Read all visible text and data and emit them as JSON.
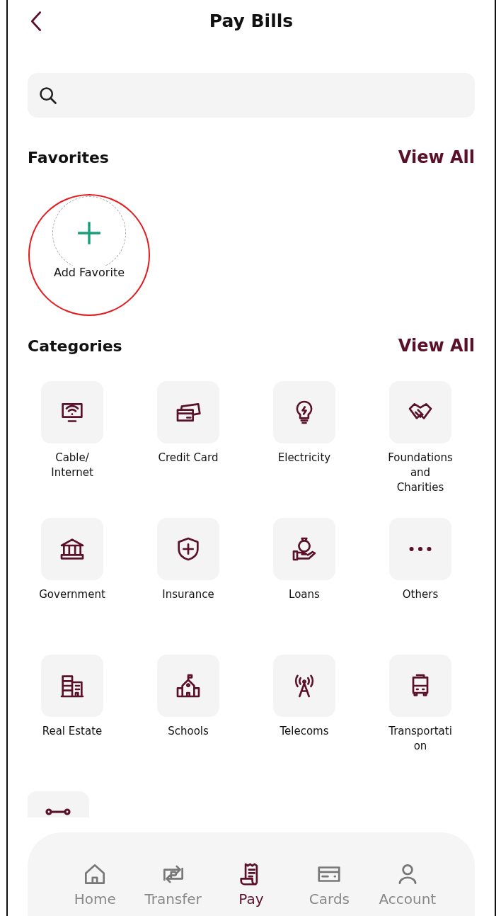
{
  "header": {
    "title": "Pay Bills"
  },
  "favorites": {
    "title": "Favorites",
    "view_all": "View All",
    "add_favorite": {
      "label": "Add Favorite",
      "highlighted": true
    }
  },
  "categories": {
    "title": "Categories",
    "view_all": "View All",
    "more_tiles_below": true,
    "items": [
      {
        "label": "Cable/ Internet"
      },
      {
        "label": "Credit Card"
      },
      {
        "label": "Electricity"
      },
      {
        "label": "Foundations and Charities"
      },
      {
        "label": "Government"
      },
      {
        "label": "Insurance"
      },
      {
        "label": "Loans"
      },
      {
        "label": "Others"
      },
      {
        "label": "Real Estate"
      },
      {
        "label": "Schools"
      },
      {
        "label": "Telecoms"
      },
      {
        "label": "Transportation"
      }
    ]
  },
  "tab_bar": [
    {
      "label": "Home",
      "selected": false
    },
    {
      "label": "Transfer",
      "selected": false
    },
    {
      "label": "Pay",
      "selected": true
    },
    {
      "label": "Cards",
      "selected": false
    },
    {
      "label": "Account",
      "selected": false
    }
  ]
}
